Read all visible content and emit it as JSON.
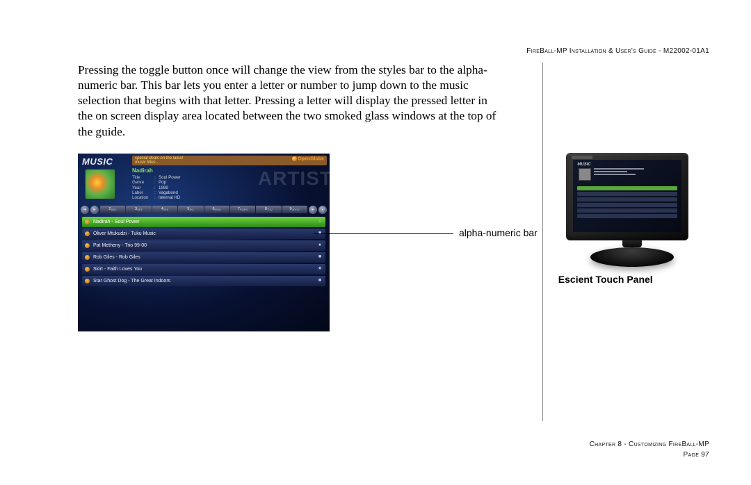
{
  "header": {
    "title": "FireBall-MP Installation & User's Guide - M22002-01A1"
  },
  "body": {
    "paragraph": "Pressing the toggle button once will change the view from the styles bar to the alpha-numeric bar.  This bar lets you enter a letter or number to jump down to the music selection that begins with that letter.  Pressing a letter will display the pressed letter in the on screen display area located between the two smoked glass windows at the top of the guide."
  },
  "music_ui": {
    "badge": "MUSIC",
    "promo_line1": "special deals on the latest",
    "promo_line2": "music titles…",
    "open_globe": "OpenGlobe",
    "artist_bg": "ARTIST",
    "artist_name": "Nadirah",
    "meta": [
      {
        "label": "Title",
        "value": "Soul Power"
      },
      {
        "label": "Genre",
        "value": "Pop"
      },
      {
        "label": "Year",
        "value": "1999"
      },
      {
        "label": "Label",
        "value": "Vagabond"
      },
      {
        "label": "Location",
        "value": "Internal HD"
      }
    ],
    "alpha_keys": [
      "ABC",
      "DEF",
      "GHI",
      "JKL",
      "MNO",
      "PQRS",
      "TUV",
      "WXYZ"
    ],
    "tracks": [
      {
        "title": "Nadirah - Soul Power",
        "active": true,
        "end": "♫"
      },
      {
        "title": "Oliver Mtukudzi - Tuku Music",
        "active": false,
        "end": "■"
      },
      {
        "title": "Pat Metheny - Trio 99-00",
        "active": false,
        "end": "●"
      },
      {
        "title": "Rob Giles - Rob Giles",
        "active": false,
        "end": "■"
      },
      {
        "title": "Skirt - Faith Loves You",
        "active": false,
        "end": "★"
      },
      {
        "title": "Star Ghost Dog - The Great Indoors",
        "active": false,
        "end": "■"
      }
    ]
  },
  "callout": {
    "label": "alpha-numeric bar"
  },
  "touch_panel": {
    "caption": "Escient Touch Panel",
    "screen_badge": "MUSIC"
  },
  "footer": {
    "chapter": "Chapter 8 - Customizing FireBall-MP",
    "page": "Page 97"
  }
}
